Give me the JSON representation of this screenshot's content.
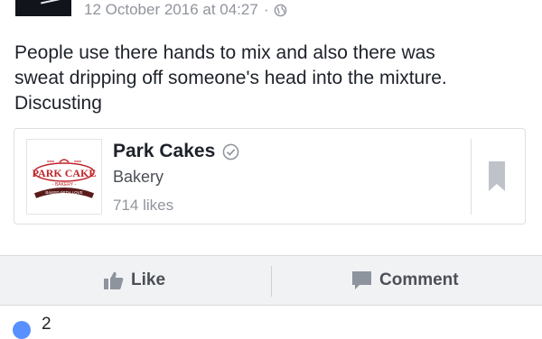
{
  "post": {
    "timestamp": "12 October 2016 at 04:27",
    "separator": "·",
    "privacy_icon": "globe-icon",
    "text_lines": [
      "People use there hands to mix and also there was",
      "sweat dripping off someone's head into the mixture.",
      "Discusting"
    ]
  },
  "tagged_page": {
    "name": "Park Cakes",
    "category": "Bakery",
    "likes": "714 likes",
    "verified_icon": "verified-check-icon",
    "save_icon": "bookmark-icon",
    "logo": {
      "brand": "PARK CAKE",
      "sub": "BAKERY",
      "tagline": "BAKED WITH LOVE"
    }
  },
  "actions": {
    "like_label": "Like",
    "comment_label": "Comment"
  },
  "reactions": {
    "count": "2"
  },
  "colors": {
    "text": "#1d2129",
    "meta": "#90949c",
    "action_bar": "#f1f2f4",
    "logo_red": "#c0252b"
  }
}
